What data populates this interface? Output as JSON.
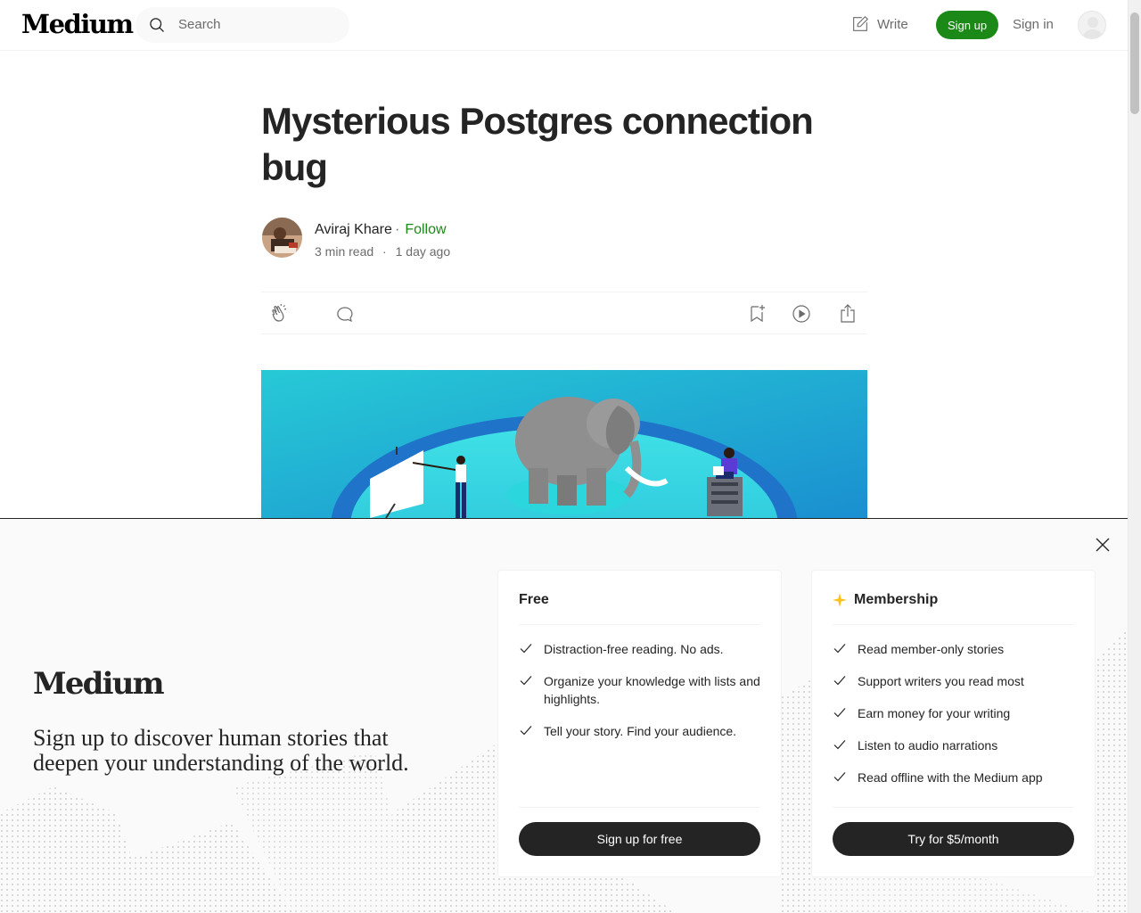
{
  "header": {
    "logo": "Medium",
    "search_placeholder": "Search",
    "write_label": "Write",
    "signup_label": "Sign up",
    "signin_label": "Sign in"
  },
  "article": {
    "title": "Mysterious Postgres connection bug",
    "author": "Aviraj Khare",
    "separator": "·",
    "follow_label": "Follow",
    "read_time": "3 min read",
    "published": "1 day ago"
  },
  "overlay": {
    "logo": "Medium",
    "tagline": "Sign up to discover human stories that deepen your understanding of the world.",
    "free": {
      "title": "Free",
      "features": [
        "Distraction-free reading. No ads.",
        "Organize your knowledge with lists and highlights.",
        "Tell your story. Find your audience."
      ],
      "button": "Sign up for free"
    },
    "membership": {
      "title": "Membership",
      "features": [
        "Read member-only stories",
        "Support writers you read most",
        "Earn money for your writing",
        "Listen to audio narrations",
        "Read offline with the Medium app"
      ],
      "button": "Try for $5/month"
    }
  },
  "colors": {
    "brand_green": "#1a8917",
    "text": "#242424",
    "muted": "#6b6b6b",
    "button_dark": "#242424",
    "sparkle": "#ffc017"
  }
}
